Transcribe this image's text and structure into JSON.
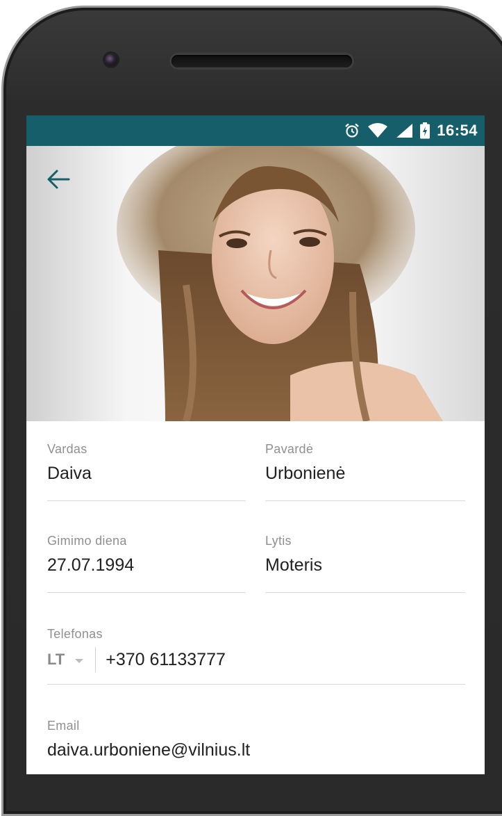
{
  "status_bar": {
    "time": "16:54",
    "icons": [
      "alarm-icon",
      "wifi-icon",
      "signal-icon",
      "battery-icon"
    ],
    "color": "#155e6a"
  },
  "header": {
    "back_icon": "arrow-left-icon",
    "accent": "#155e6a"
  },
  "form": {
    "first_name": {
      "label": "Vardas",
      "value": "Daiva"
    },
    "last_name": {
      "label": "Pavardė",
      "value": "Urbonienė"
    },
    "birthday": {
      "label": "Gimimo diena",
      "value": "27.07.1994"
    },
    "gender": {
      "label": "Lytis",
      "value": "Moteris"
    },
    "phone": {
      "label": "Telefonas",
      "country": "LT",
      "value": "+370 61133777"
    },
    "email": {
      "label": "Email",
      "value": "daiva.urboniene@vilnius.lt"
    }
  }
}
